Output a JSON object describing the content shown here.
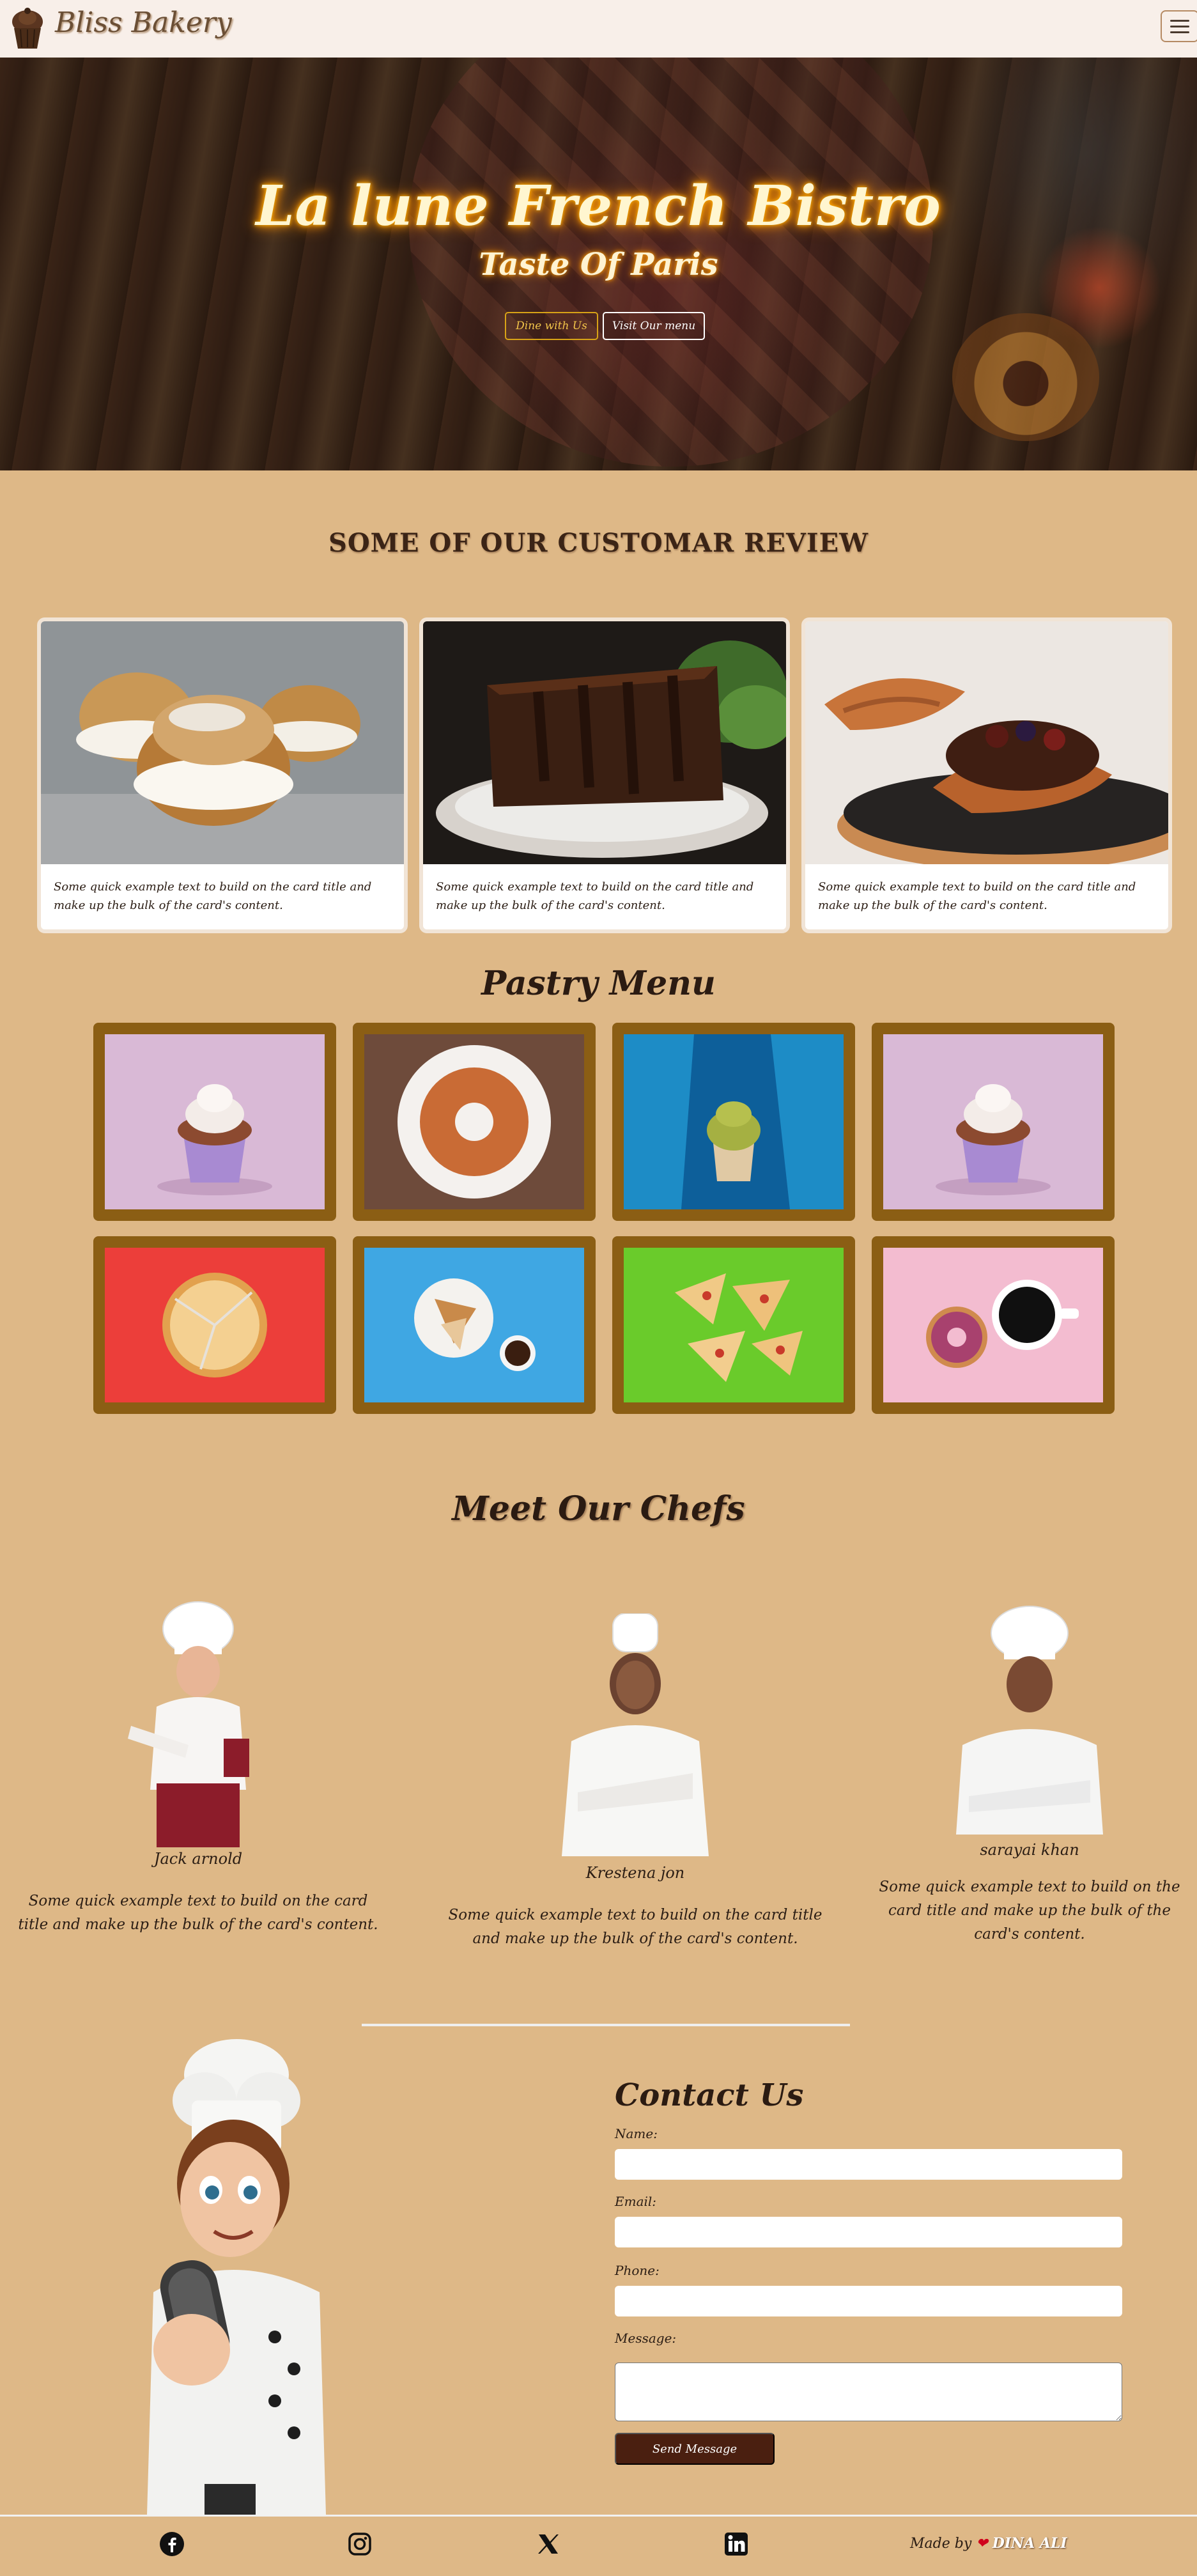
{
  "navbar": {
    "brand": "Bliss Bakery",
    "logo_icon": "cupcake-logo-icon",
    "toggler_icon": "hamburger-menu-icon"
  },
  "hero": {
    "title": "La lune French Bistro",
    "subtitle": "Taste Of Paris",
    "dine_label": "Dine with Us",
    "menu_label": "Visit Our menu"
  },
  "reviews": {
    "heading": "SOME OF OUR CUSTOMAR REVIEW",
    "cards": [
      {
        "image": "cream-puffs-photo",
        "text": "Some quick example text to build on the card title and make up the bulk of the card's content."
      },
      {
        "image": "chocolate-cake-slice-photo",
        "text": "Some quick example text to build on the card title and make up the bulk of the card's content."
      },
      {
        "image": "croissant-pastry-photo",
        "text": "Some quick example text to build on the card title and make up the bulk of the card's content."
      }
    ]
  },
  "pastry_menu": {
    "heading": "Pastry Menu",
    "items": [
      {
        "image": "cupcake-photo"
      },
      {
        "image": "bundt-cake-photo"
      },
      {
        "image": "green-cupcake-photo"
      },
      {
        "image": "cupcake-photo"
      },
      {
        "image": "pizza-photo"
      },
      {
        "image": "pie-and-coffee-photo"
      },
      {
        "image": "pizza-slices-photo"
      },
      {
        "image": "donut-and-coffee-photo"
      }
    ]
  },
  "chefs": {
    "heading": "Meet Our Chefs",
    "list": [
      {
        "name": "Jack arnold",
        "text": "Some quick example text to build on the card title and make up the bulk of the card's content."
      },
      {
        "name": "Krestena jon",
        "text": "Some quick example text to build on the card title and make up the bulk of the card's content."
      },
      {
        "name": "sarayai khan",
        "text": "Some quick example text to build on the card title and make up the bulk of the card's content."
      }
    ]
  },
  "contact": {
    "heading": "Contact Us",
    "name_label": "Name:",
    "email_label": "Email:",
    "phone_label": "Phone:",
    "message_label": "Message:",
    "send_label": "Send Message",
    "mascot": "chef-mascot-illustration"
  },
  "footer": {
    "icons": [
      "facebook-icon",
      "instagram-icon",
      "x-twitter-icon",
      "linkedin-icon"
    ],
    "made_by": "Made by",
    "author": "DINA ALI"
  },
  "colors": {
    "page_background": "#deb887",
    "navbar_background": "#f8efe9",
    "tile_frame": "#8b5e14",
    "send_button": "#4a1f10",
    "neon_glow": "#ff9800",
    "dine_button_border": "#d8a316"
  }
}
